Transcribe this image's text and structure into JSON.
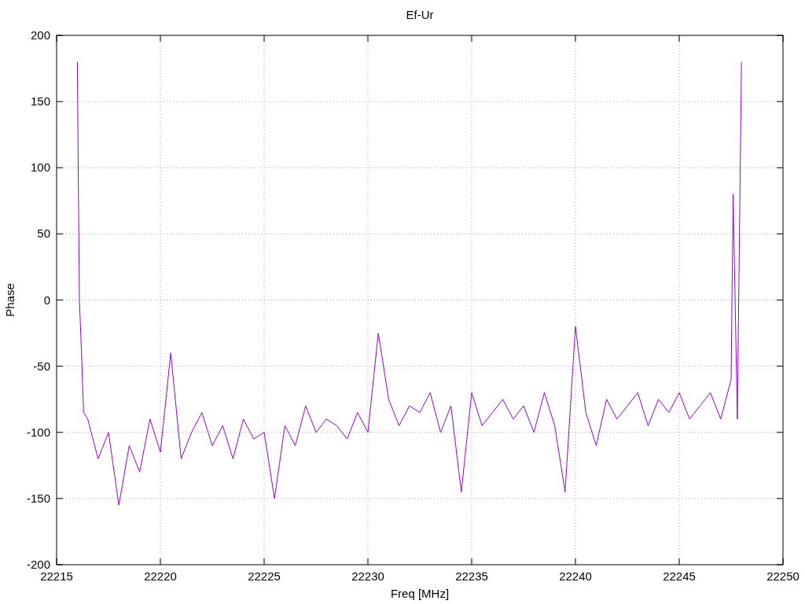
{
  "chart_data": {
    "type": "line",
    "title": "Ef-Ur",
    "xlabel": "Freq [MHz]",
    "ylabel": "Phase",
    "x": [
      22216,
      22216.05,
      22216.1,
      22216.2,
      22216.3,
      22216.5,
      22217,
      22217.5,
      22218,
      22218.5,
      22219,
      22219.5,
      22220,
      22220.5,
      22221,
      22221.5,
      22222,
      22222.5,
      22223,
      22223.5,
      22224,
      22224.5,
      22225,
      22225.5,
      22226,
      22226.5,
      22227,
      22227.5,
      22228,
      22228.5,
      22229,
      22229.5,
      22230,
      22230.5,
      22231,
      22231.5,
      22232,
      22232.5,
      22233,
      22233.5,
      22234,
      22234.5,
      22235,
      22235.5,
      22236,
      22236.5,
      22237,
      22237.5,
      22238,
      22238.5,
      22239,
      22239.5,
      22240,
      22240.5,
      22241,
      22241.5,
      22242,
      22242.5,
      22243,
      22243.5,
      22244,
      22244.5,
      22245,
      22245.5,
      22246,
      22246.5,
      22247,
      22247.5,
      22247.6,
      22247.8,
      22248
    ],
    "series": [
      {
        "color": "#9400d3",
        "values": [
          180,
          85,
          0,
          -40,
          -85,
          -90,
          -120,
          -100,
          -155,
          -110,
          -130,
          -90,
          -115,
          -40,
          -120,
          -100,
          -85,
          -110,
          -95,
          -120,
          -90,
          -105,
          -100,
          -150,
          -95,
          -110,
          -80,
          -100,
          -90,
          -95,
          -105,
          -85,
          -100,
          -25,
          -75,
          -95,
          -80,
          -85,
          -70,
          -100,
          -80,
          -145,
          -70,
          -95,
          -85,
          -75,
          -90,
          -80,
          -100,
          -70,
          -95,
          -145,
          -20,
          -85,
          -110,
          -75,
          -90,
          -80,
          -70,
          -95,
          -75,
          -85,
          -70,
          -90,
          -80,
          -70,
          -90,
          -60,
          80,
          -90,
          180
        ]
      }
    ],
    "xlim": [
      22215,
      22250
    ],
    "ylim": [
      -200,
      200
    ],
    "xticks": [
      22215,
      22220,
      22225,
      22230,
      22235,
      22240,
      22245,
      22250
    ],
    "yticks": [
      -200,
      -150,
      -100,
      -50,
      0,
      50,
      100,
      150,
      200
    ],
    "grid": true
  }
}
